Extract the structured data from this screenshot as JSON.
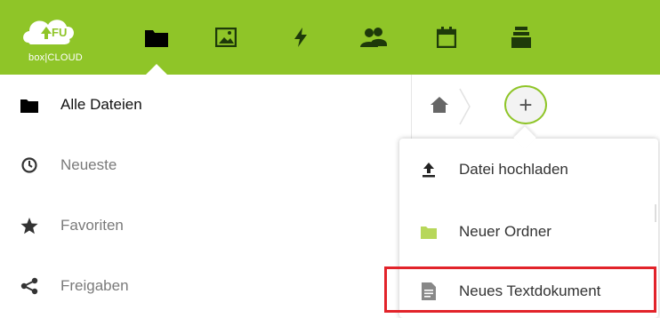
{
  "header": {
    "logo_text": "box|CLOUD",
    "logo_badge": "FU",
    "apps": [
      {
        "name": "files",
        "icon": "folder-icon",
        "active": true
      },
      {
        "name": "gallery",
        "icon": "image-icon",
        "active": false
      },
      {
        "name": "activity",
        "icon": "lightning-icon",
        "active": false
      },
      {
        "name": "contacts",
        "icon": "users-icon",
        "active": false
      },
      {
        "name": "calendar",
        "icon": "calendar-icon",
        "active": false
      },
      {
        "name": "deck",
        "icon": "stack-icon",
        "active": false
      }
    ],
    "bg_color": "#8fc528"
  },
  "sidebar": {
    "items": [
      {
        "label": "Alle Dateien",
        "icon": "folder-icon",
        "active": true
      },
      {
        "label": "Neueste",
        "icon": "clock-icon",
        "active": false
      },
      {
        "label": "Favoriten",
        "icon": "star-icon",
        "active": false
      },
      {
        "label": "Freigaben",
        "icon": "share-icon",
        "active": false
      }
    ]
  },
  "breadcrumb": {
    "home_icon": "home-icon",
    "add_label": "+"
  },
  "new_menu": {
    "items": [
      {
        "label": "Datei hochladen",
        "icon": "upload-icon"
      },
      {
        "label": "Neuer Ordner",
        "icon": "folder-icon"
      },
      {
        "label": "Neues Textdokument",
        "icon": "text-file-icon"
      }
    ],
    "highlight_color": "#e2232a"
  }
}
